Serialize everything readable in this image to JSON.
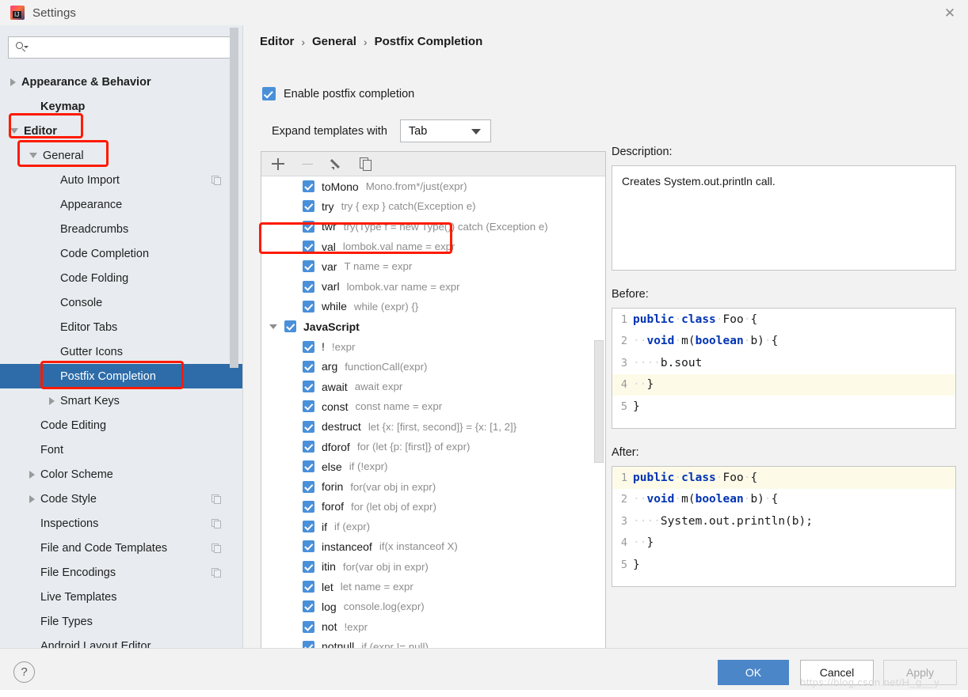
{
  "window": {
    "title": "Settings",
    "logo_letters": "IJ",
    "close_icon": "✕"
  },
  "sidebar": {
    "search": {
      "value": "",
      "placeholder": ""
    },
    "items": [
      {
        "label": "Appearance & Behavior",
        "indent": 0,
        "twisty": "closed",
        "bold": true,
        "selected": false,
        "badge": false
      },
      {
        "label": "Keymap",
        "indent": 1,
        "twisty": "none",
        "bold": true,
        "selected": false,
        "badge": false
      },
      {
        "label": "Editor",
        "indent": 0,
        "twisty": "open",
        "bold": true,
        "selected": false,
        "badge": false
      },
      {
        "label": "General",
        "indent": 1,
        "twisty": "open",
        "bold": false,
        "selected": false,
        "badge": false
      },
      {
        "label": "Auto Import",
        "indent": 2,
        "twisty": "none",
        "bold": false,
        "selected": false,
        "badge": true
      },
      {
        "label": "Appearance",
        "indent": 2,
        "twisty": "none",
        "bold": false,
        "selected": false,
        "badge": false
      },
      {
        "label": "Breadcrumbs",
        "indent": 2,
        "twisty": "none",
        "bold": false,
        "selected": false,
        "badge": false
      },
      {
        "label": "Code Completion",
        "indent": 2,
        "twisty": "none",
        "bold": false,
        "selected": false,
        "badge": false
      },
      {
        "label": "Code Folding",
        "indent": 2,
        "twisty": "none",
        "bold": false,
        "selected": false,
        "badge": false
      },
      {
        "label": "Console",
        "indent": 2,
        "twisty": "none",
        "bold": false,
        "selected": false,
        "badge": false
      },
      {
        "label": "Editor Tabs",
        "indent": 2,
        "twisty": "none",
        "bold": false,
        "selected": false,
        "badge": false
      },
      {
        "label": "Gutter Icons",
        "indent": 2,
        "twisty": "none",
        "bold": false,
        "selected": false,
        "badge": false
      },
      {
        "label": "Postfix Completion",
        "indent": 2,
        "twisty": "none",
        "bold": false,
        "selected": true,
        "badge": false
      },
      {
        "label": "Smart Keys",
        "indent": 2,
        "twisty": "closed",
        "bold": false,
        "selected": false,
        "badge": false
      },
      {
        "label": "Code Editing",
        "indent": 1,
        "twisty": "none",
        "bold": false,
        "selected": false,
        "badge": false
      },
      {
        "label": "Font",
        "indent": 1,
        "twisty": "none",
        "bold": false,
        "selected": false,
        "badge": false
      },
      {
        "label": "Color Scheme",
        "indent": 1,
        "twisty": "closed",
        "bold": false,
        "selected": false,
        "badge": false
      },
      {
        "label": "Code Style",
        "indent": 1,
        "twisty": "closed",
        "bold": false,
        "selected": false,
        "badge": true
      },
      {
        "label": "Inspections",
        "indent": 1,
        "twisty": "none",
        "bold": false,
        "selected": false,
        "badge": true
      },
      {
        "label": "File and Code Templates",
        "indent": 1,
        "twisty": "none",
        "bold": false,
        "selected": false,
        "badge": true
      },
      {
        "label": "File Encodings",
        "indent": 1,
        "twisty": "none",
        "bold": false,
        "selected": false,
        "badge": true
      },
      {
        "label": "Live Templates",
        "indent": 1,
        "twisty": "none",
        "bold": false,
        "selected": false,
        "badge": false
      },
      {
        "label": "File Types",
        "indent": 1,
        "twisty": "none",
        "bold": false,
        "selected": false,
        "badge": false
      },
      {
        "label": "Android Layout Editor",
        "indent": 1,
        "twisty": "none",
        "bold": false,
        "selected": false,
        "badge": false
      }
    ]
  },
  "main": {
    "breadcrumb": [
      "Editor",
      "General",
      "Postfix Completion"
    ],
    "breadcrumb_separator": "›",
    "enable_checkbox": {
      "label": "Enable postfix completion",
      "checked": true
    },
    "expand_templates": {
      "label": "Expand templates with",
      "value": "Tab"
    },
    "toolbar": {
      "add_icon": "plus-icon",
      "remove_icon": "minus-icon",
      "edit_icon": "pencil-icon",
      "copy_icon": "copy-icon"
    },
    "templates": [
      {
        "type": "item",
        "name": "toMono",
        "desc": "Mono.from*/just(expr)",
        "checked": true,
        "indent": 2
      },
      {
        "type": "item",
        "name": "try",
        "desc": "try { exp } catch(Exception e)",
        "checked": true,
        "indent": 2
      },
      {
        "type": "item",
        "name": "twr",
        "desc": "try(Type f = new Type()) catch (Exception e)",
        "checked": true,
        "indent": 2
      },
      {
        "type": "item",
        "name": "val",
        "desc": "lombok.val name = expr",
        "checked": true,
        "indent": 2
      },
      {
        "type": "item",
        "name": "var",
        "desc": "T name = expr",
        "checked": true,
        "indent": 2
      },
      {
        "type": "item",
        "name": "varl",
        "desc": "lombok.var name = expr",
        "checked": true,
        "indent": 2
      },
      {
        "type": "item",
        "name": "while",
        "desc": "while (expr) {}",
        "checked": true,
        "indent": 2
      },
      {
        "type": "group",
        "name": "JavaScript",
        "desc": "",
        "checked": true,
        "indent": 0
      },
      {
        "type": "item",
        "name": "!",
        "desc": "!expr",
        "checked": true,
        "indent": 2
      },
      {
        "type": "item",
        "name": "arg",
        "desc": "functionCall(expr)",
        "checked": true,
        "indent": 2
      },
      {
        "type": "item",
        "name": "await",
        "desc": "await expr",
        "checked": true,
        "indent": 2
      },
      {
        "type": "item",
        "name": "const",
        "desc": "const name = expr",
        "checked": true,
        "indent": 2
      },
      {
        "type": "item",
        "name": "destruct",
        "desc": "let {x: [first, second]} = {x: [1, 2]}",
        "checked": true,
        "indent": 2
      },
      {
        "type": "item",
        "name": "dforof",
        "desc": "for (let {p: [first]} of expr)",
        "checked": true,
        "indent": 2
      },
      {
        "type": "item",
        "name": "else",
        "desc": "if (!expr)",
        "checked": true,
        "indent": 2
      },
      {
        "type": "item",
        "name": "forin",
        "desc": "for(var obj in expr)",
        "checked": true,
        "indent": 2
      },
      {
        "type": "item",
        "name": "forof",
        "desc": "for (let obj of expr)",
        "checked": true,
        "indent": 2
      },
      {
        "type": "item",
        "name": "if",
        "desc": "if (expr)",
        "checked": true,
        "indent": 2
      },
      {
        "type": "item",
        "name": "instanceof",
        "desc": "if(x instanceof X)",
        "checked": true,
        "indent": 2
      },
      {
        "type": "item",
        "name": "itin",
        "desc": "for(var obj in expr)",
        "checked": true,
        "indent": 2
      },
      {
        "type": "item",
        "name": "let",
        "desc": "let name = expr",
        "checked": true,
        "indent": 2
      },
      {
        "type": "item",
        "name": "log",
        "desc": "console.log(expr)",
        "checked": true,
        "indent": 2
      },
      {
        "type": "item",
        "name": "not",
        "desc": "!expr",
        "checked": true,
        "indent": 2
      },
      {
        "type": "item",
        "name": "notnull",
        "desc": "if (expr != null)",
        "checked": true,
        "indent": 2
      }
    ]
  },
  "detail": {
    "description_label": "Description:",
    "description_text": "Creates System.out.println call.",
    "before_label": "Before:",
    "after_label": "After:",
    "before_code": [
      {
        "num": "1",
        "highlight": false,
        "tokens": [
          {
            "t": "public",
            "k": "kw"
          },
          {
            "t": "·",
            "k": "ws"
          },
          {
            "t": "class",
            "k": "kw"
          },
          {
            "t": "·",
            "k": "ws"
          },
          {
            "t": "Foo",
            "k": ""
          },
          {
            "t": "·",
            "k": "ws"
          },
          {
            "t": "{",
            "k": ""
          }
        ]
      },
      {
        "num": "2",
        "highlight": false,
        "tokens": [
          {
            "t": "··",
            "k": "ws"
          },
          {
            "t": "void",
            "k": "kw"
          },
          {
            "t": "·",
            "k": "ws"
          },
          {
            "t": "m(",
            "k": ""
          },
          {
            "t": "boolean",
            "k": "kw"
          },
          {
            "t": "·",
            "k": "ws"
          },
          {
            "t": "b)",
            "k": ""
          },
          {
            "t": "·",
            "k": "ws"
          },
          {
            "t": "{",
            "k": ""
          }
        ]
      },
      {
        "num": "3",
        "highlight": false,
        "tokens": [
          {
            "t": "····",
            "k": "ws"
          },
          {
            "t": "b.sout",
            "k": ""
          }
        ]
      },
      {
        "num": "4",
        "highlight": true,
        "tokens": [
          {
            "t": "··",
            "k": "ws"
          },
          {
            "t": "}",
            "k": ""
          }
        ]
      },
      {
        "num": "5",
        "highlight": false,
        "tokens": [
          {
            "t": "}",
            "k": ""
          }
        ]
      }
    ],
    "after_code": [
      {
        "num": "1",
        "highlight": true,
        "tokens": [
          {
            "t": "public",
            "k": "kw"
          },
          {
            "t": "·",
            "k": "ws"
          },
          {
            "t": "class",
            "k": "kw"
          },
          {
            "t": "·",
            "k": "ws"
          },
          {
            "t": "Foo",
            "k": ""
          },
          {
            "t": "·",
            "k": "ws"
          },
          {
            "t": "{",
            "k": ""
          }
        ]
      },
      {
        "num": "2",
        "highlight": false,
        "tokens": [
          {
            "t": "··",
            "k": "ws"
          },
          {
            "t": "void",
            "k": "kw"
          },
          {
            "t": "·",
            "k": "ws"
          },
          {
            "t": "m(",
            "k": ""
          },
          {
            "t": "boolean",
            "k": "kw"
          },
          {
            "t": "·",
            "k": "ws"
          },
          {
            "t": "b)",
            "k": ""
          },
          {
            "t": "·",
            "k": "ws"
          },
          {
            "t": "{",
            "k": ""
          }
        ]
      },
      {
        "num": "3",
        "highlight": false,
        "tokens": [
          {
            "t": "····",
            "k": "ws"
          },
          {
            "t": "System.out.println(b);",
            "k": ""
          }
        ]
      },
      {
        "num": "4",
        "highlight": false,
        "tokens": [
          {
            "t": "··",
            "k": "ws"
          },
          {
            "t": "}",
            "k": ""
          }
        ]
      },
      {
        "num": "5",
        "highlight": false,
        "tokens": [
          {
            "t": "}",
            "k": ""
          }
        ]
      }
    ]
  },
  "footer": {
    "help_label": "?",
    "ok_label": "OK",
    "cancel_label": "Cancel",
    "apply_label": "Apply",
    "watermark": "https://blog.csdn.net/H_g__y"
  },
  "colors": {
    "accent_blue": "#4a90d9",
    "selection_blue": "#2d6ca8",
    "annotation_red": "#ff1a00",
    "keyword_blue": "#0033b3",
    "highlight_line": "#fdfbe8"
  }
}
